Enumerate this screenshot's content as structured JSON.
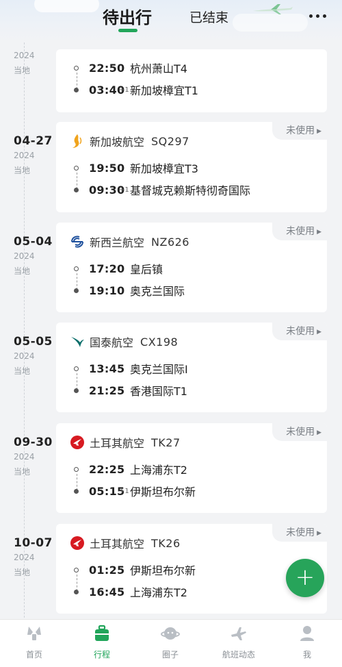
{
  "header": {
    "tab_active": "待出行",
    "tab_inactive": "已结束"
  },
  "trips": [
    {
      "date": "",
      "year": "2024",
      "local": "当地",
      "status": "",
      "airline": "",
      "flight_no": "",
      "dep_time": "22:50",
      "dep_place": "杭州萧山T4",
      "arr_time": "03:40",
      "arr_plus": "+1",
      "arr_place": "新加坡樟宜T1"
    },
    {
      "date": "04-27",
      "year": "2024",
      "local": "当地",
      "status": "未使用",
      "airline": "新加坡航空",
      "flight_no": "SQ297",
      "dep_time": "19:50",
      "dep_place": "新加坡樟宜T3",
      "arr_time": "09:30",
      "arr_plus": "+1",
      "arr_place": "基督城克赖斯特彻奇国际"
    },
    {
      "date": "05-04",
      "year": "2024",
      "local": "当地",
      "status": "未使用",
      "airline": "新西兰航空",
      "flight_no": "NZ626",
      "dep_time": "17:20",
      "dep_place": "皇后镇",
      "arr_time": "19:10",
      "arr_plus": "",
      "arr_place": "奥克兰国际"
    },
    {
      "date": "05-05",
      "year": "2024",
      "local": "当地",
      "status": "未使用",
      "airline": "国泰航空",
      "flight_no": "CX198",
      "dep_time": "13:45",
      "dep_place": "奥克兰国际I",
      "arr_time": "21:25",
      "arr_plus": "",
      "arr_place": "香港国际T1"
    },
    {
      "date": "09-30",
      "year": "2024",
      "local": "当地",
      "status": "未使用",
      "airline": "土耳其航空",
      "flight_no": "TK27",
      "dep_time": "22:25",
      "dep_place": "上海浦东T2",
      "arr_time": "05:15",
      "arr_plus": "+1",
      "arr_place": "伊斯坦布尔新"
    },
    {
      "date": "10-07",
      "year": "2024",
      "local": "当地",
      "status": "未使用",
      "airline": "土耳其航空",
      "flight_no": "TK26",
      "dep_time": "01:25",
      "dep_place": "伊斯坦布尔新",
      "arr_time": "16:45",
      "arr_plus": "",
      "arr_place": "上海浦东T2"
    }
  ],
  "fab": {
    "label": "+"
  },
  "nav": {
    "home": "首页",
    "trips": "行程",
    "circle": "圈子",
    "flight_status": "航班动态",
    "me": "我"
  },
  "colors": {
    "accent": "#21a55a",
    "singapore": "#f0a31c",
    "air_nz": "#1d4f9c",
    "cathay": "#0a6e6a",
    "turkish": "#d71a21"
  }
}
